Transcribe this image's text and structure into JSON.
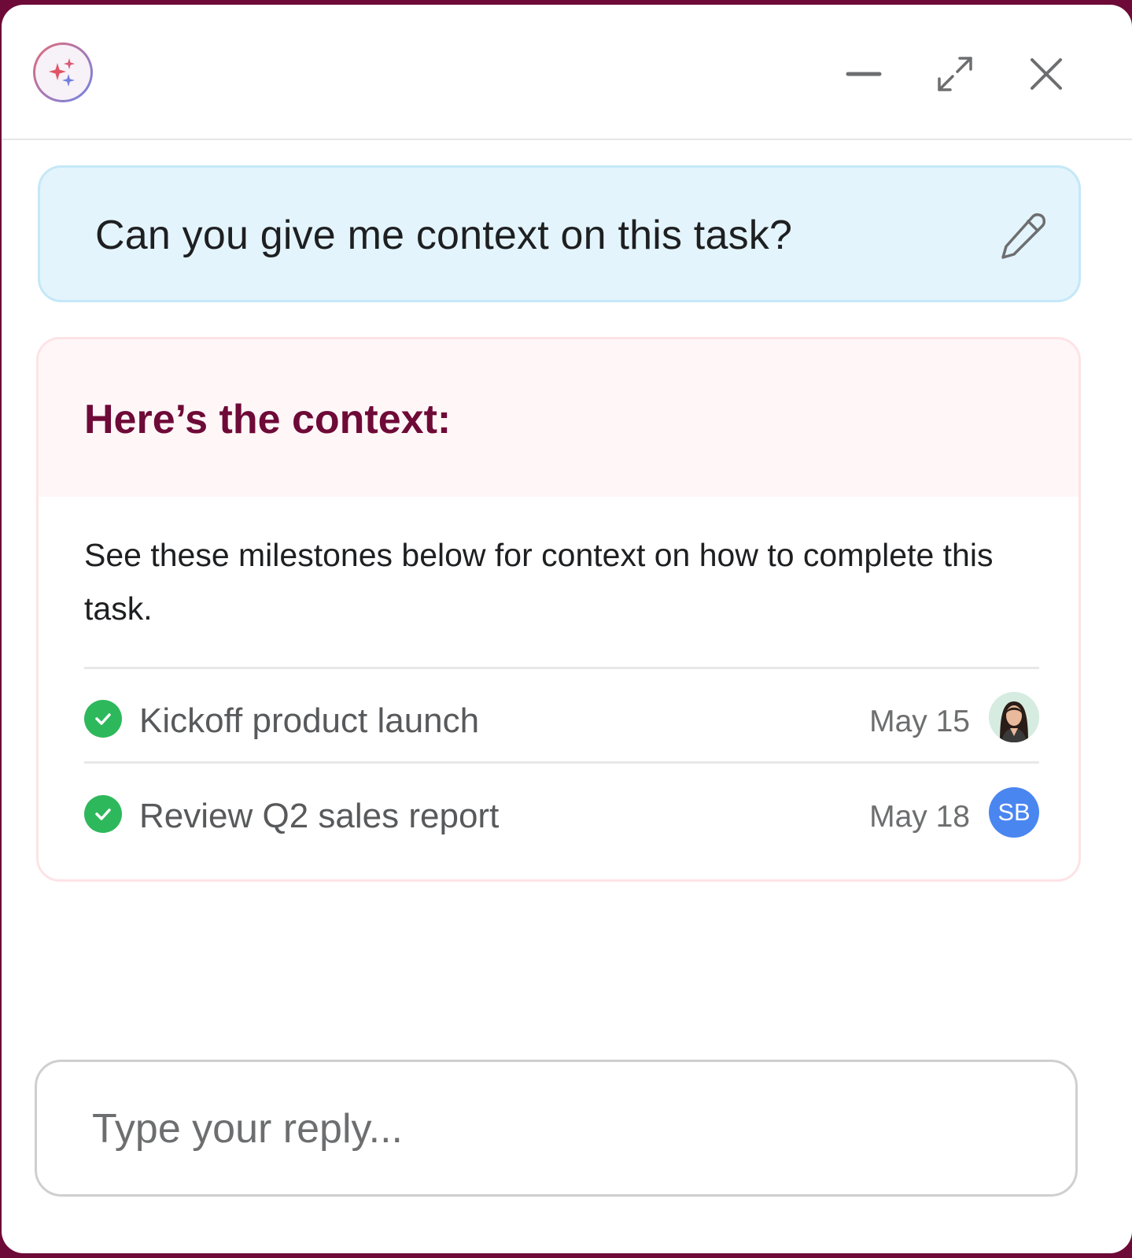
{
  "header": {
    "logo_icon": "sparkles-icon",
    "minimize_icon": "minimize-icon",
    "expand_icon": "expand-icon",
    "close_icon": "close-icon"
  },
  "question": {
    "text": "Can you give me context on this task?",
    "edit_icon": "pencil-icon"
  },
  "answer": {
    "title": "Here’s the context:",
    "description": "See these milestones below for context on how to complete this task.",
    "milestones": [
      {
        "name": "Kickoff product launch",
        "date": "May 15",
        "assignee_type": "photo",
        "status": "complete"
      },
      {
        "name": "Review Q2 sales report",
        "date": "May 18",
        "assignee_initials": "SB",
        "assignee_color": "#4a86f0",
        "status": "complete"
      }
    ]
  },
  "reply": {
    "placeholder": "Type your reply..."
  },
  "colors": {
    "brand": "#6e0a37",
    "question_bg": "#e3f4fc",
    "answer_head_bg": "#fff6f7",
    "check_green": "#2eb85c"
  }
}
